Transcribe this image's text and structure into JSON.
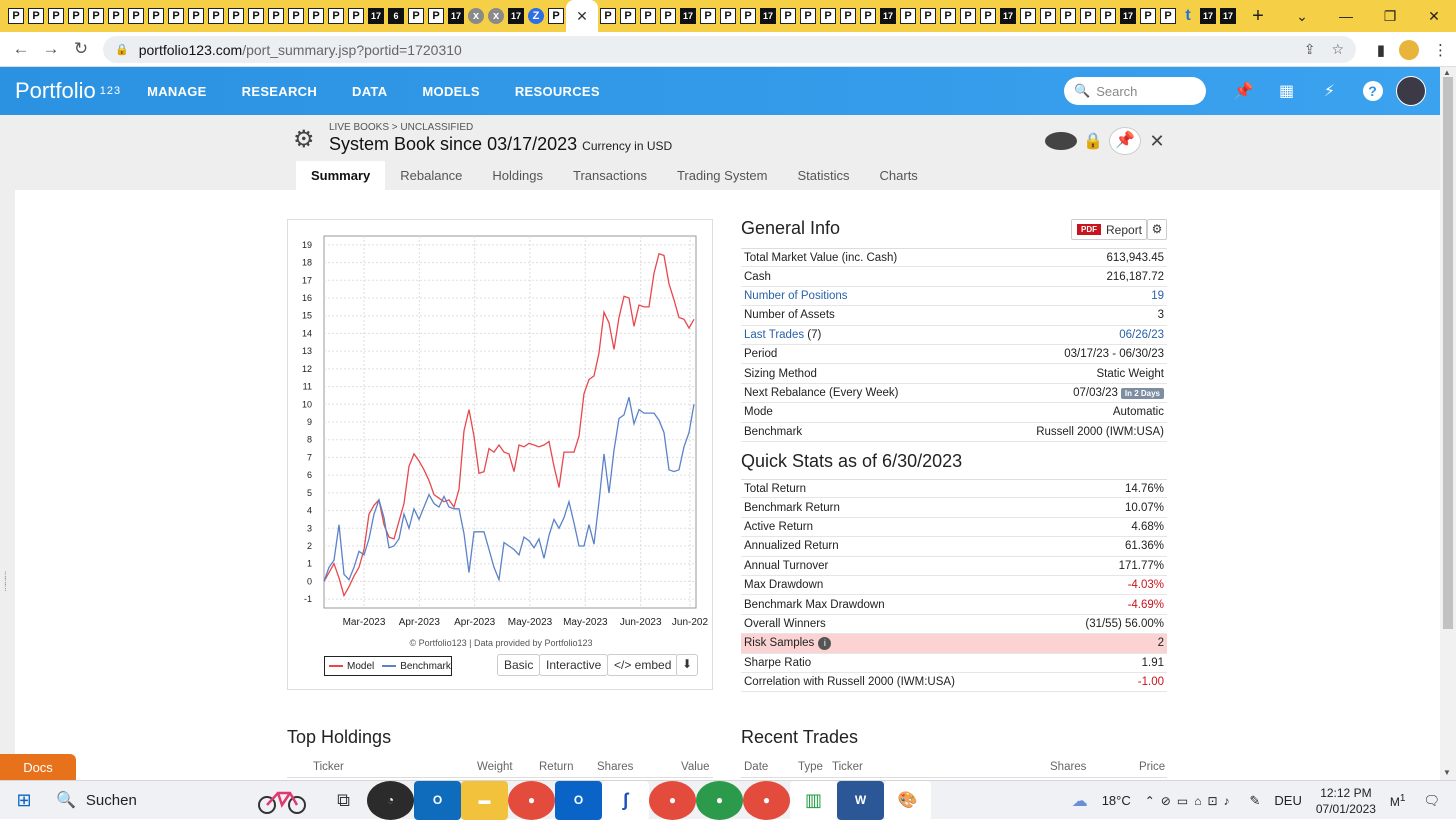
{
  "browser": {
    "tab_favicons": [
      "P",
      "P",
      "P",
      "P",
      "P",
      "P",
      "P",
      "P",
      "P",
      "P",
      "P",
      "P",
      "P",
      "P",
      "P",
      "P",
      "P",
      "P",
      "17",
      "6",
      "P",
      "P",
      "17",
      "x",
      "x",
      "17",
      "Z",
      "P"
    ],
    "active_tab_close": "✕",
    "tab_favicons_right": [
      "P",
      "P",
      "P",
      "P",
      "17",
      "P",
      "P",
      "P",
      "17",
      "P",
      "P",
      "P",
      "P",
      "P",
      "17",
      "P",
      "P",
      "P",
      "P",
      "P",
      "17",
      "P",
      "P",
      "P",
      "P",
      "P",
      "17",
      "P",
      "P",
      "t",
      "17",
      "17"
    ],
    "new_tab": "+",
    "url_host": "portfolio123.com",
    "url_path": "/port_summary.jsp?portid=1720310"
  },
  "app": {
    "logo_text": "Portfolio",
    "logo_digits": "123",
    "nav": [
      "MANAGE",
      "RESEARCH",
      "DATA",
      "MODELS",
      "RESOURCES"
    ],
    "search_placeholder": "Search",
    "help_label": "?"
  },
  "book": {
    "breadcrumb": "LIVE BOOKS > UNCLASSIFIED",
    "title": "System Book since 03/17/2023",
    "currency": "Currency in USD",
    "info_label": "i",
    "tabs": [
      "Summary",
      "Rebalance",
      "Holdings",
      "Transactions",
      "Trading System",
      "Statistics",
      "Charts"
    ],
    "active_tab": "Summary"
  },
  "chart_panel": {
    "copyright": "© Portfolio123 | Data provided by Portfolio123",
    "buttons": [
      "Basic",
      "Interactive",
      "</> embed"
    ]
  },
  "chart_data": {
    "type": "line",
    "x_ticks": [
      "Mar-2023",
      "Apr-2023",
      "Apr-2023",
      "May-2023",
      "May-2023",
      "Jun-2023",
      "Jun-202"
    ],
    "y_ticks": [
      -1,
      0,
      1,
      2,
      3,
      4,
      5,
      6,
      7,
      8,
      9,
      10,
      11,
      12,
      13,
      14,
      15,
      16,
      17,
      18,
      19
    ],
    "ylim": [
      -1.5,
      19.5
    ],
    "grid": true,
    "legend_position": "bottom-left",
    "series": [
      {
        "name": "Model",
        "color": "#e8474c",
        "values": [
          0,
          0.5,
          1,
          0.2,
          -0.8,
          -0.3,
          0.3,
          0.8,
          1.8,
          3.8,
          4.3,
          4.6,
          3.2,
          2.5,
          2.4,
          3.4,
          4.4,
          6.5,
          7.2,
          6.8,
          6.3,
          5.7,
          4.9,
          4.7,
          4.5,
          4.6,
          4.2,
          5.2,
          8.5,
          9.7,
          8.2,
          6.1,
          6.2,
          7.5,
          7.3,
          7.7,
          7.3,
          7.2,
          6.2,
          7.7,
          7.6,
          7.8,
          7.7,
          7.6,
          7.7,
          7.9,
          6.5,
          5.3,
          7.3,
          7.3,
          7.3,
          8.2,
          10.6,
          11.4,
          11.6,
          12.9,
          15.2,
          14.6,
          13.1,
          14.9,
          16.1,
          16.0,
          14.4,
          15.6,
          15.5,
          15.5,
          17.4,
          18.5,
          18.4,
          16.8,
          15.9,
          14.9,
          14.8,
          14.3,
          14.8
        ]
      },
      {
        "name": "Benchmark",
        "color": "#5b82c8",
        "values": [
          0,
          0.8,
          1.2,
          3.2,
          0.4,
          0.1,
          0.8,
          1.7,
          1.5,
          2.4,
          3.8,
          4.6,
          3.6,
          1.9,
          2.0,
          2.4,
          3.8,
          3.0,
          4.1,
          3.5,
          4.2,
          4.9,
          4.4,
          4.2,
          4.8,
          4.2,
          4.1,
          4.1,
          2.7,
          0.5,
          2.8,
          2.8,
          2.8,
          1.8,
          0.8,
          0.1,
          2.2,
          2.0,
          1.8,
          1.5,
          2.5,
          2.3,
          1.9,
          2.4,
          1.3,
          2.6,
          3.5,
          3.0,
          3.6,
          4.5,
          3.3,
          2.0,
          2.0,
          3.2,
          2.1,
          4.5,
          7.2,
          5.0,
          7.4,
          9.2,
          9.4,
          10.4,
          8.9,
          9.7,
          9.5,
          9.5,
          9.5,
          9.1,
          8.4,
          6.3,
          6.2,
          6.3,
          7.6,
          8.4,
          10.0
        ]
      }
    ]
  },
  "general_info": {
    "title": "General Info",
    "pdf_label": "PDF",
    "report_label": "Report",
    "rows": [
      {
        "label": "Total Market Value (inc. Cash)",
        "value": "613,943.45"
      },
      {
        "label": "Cash",
        "value": "216,187.72"
      },
      {
        "label": "Number of Positions",
        "value": "19",
        "link": true
      },
      {
        "label": "Number of Assets",
        "value": "3"
      },
      {
        "label": "Last Trades",
        "label_suffix": " (7)",
        "value": "06/26/23",
        "link": true
      },
      {
        "label": "Period",
        "value": "03/17/23 - 06/30/23"
      },
      {
        "label": "Sizing Method",
        "value": "Static Weight"
      },
      {
        "label": "Next Rebalance (Every Week)",
        "value": "07/03/23",
        "badge": "In 2 Days"
      },
      {
        "label": "Mode",
        "value": "Automatic"
      },
      {
        "label": "Benchmark",
        "value": "Russell 2000 (IWM:USA)"
      }
    ]
  },
  "quick_stats": {
    "title": "Quick Stats as of 6/30/2023",
    "rows": [
      {
        "label": "Total Return",
        "value": "14.76%"
      },
      {
        "label": "Benchmark Return",
        "value": "10.07%"
      },
      {
        "label": "Active Return",
        "value": "4.68%"
      },
      {
        "label": "Annualized Return",
        "value": "61.36%"
      },
      {
        "label": "Annual Turnover",
        "value": "171.77%"
      },
      {
        "label": "Max Drawdown",
        "value": "-4.03%",
        "neg": true
      },
      {
        "label": "Benchmark Max Drawdown",
        "value": "-4.69%",
        "neg": true
      },
      {
        "label": "Overall Winners",
        "value": "(31/55) 56.00%"
      },
      {
        "label": "Risk Samples",
        "value": "2",
        "highlight": true,
        "info": "i"
      },
      {
        "label": "Sharpe Ratio",
        "value": "1.91"
      },
      {
        "label": "Correlation with Russell 2000 (IWM:USA)",
        "value": "-1.00",
        "neg": true
      }
    ]
  },
  "top_holdings": {
    "title": "Top Holdings",
    "columns": [
      "Ticker",
      "Weight",
      "Return",
      "Shares",
      "Value"
    ]
  },
  "recent_trades": {
    "title": "Recent Trades",
    "columns": [
      "Date",
      "Type",
      "Ticker",
      "Shares",
      "Price"
    ]
  },
  "docs_label": "Docs",
  "taskbar": {
    "search_label": "Suchen",
    "weather": "18°C",
    "lang": "DEU",
    "time": "12:12 PM",
    "date": "07/01/2023",
    "notif_count": "1"
  }
}
